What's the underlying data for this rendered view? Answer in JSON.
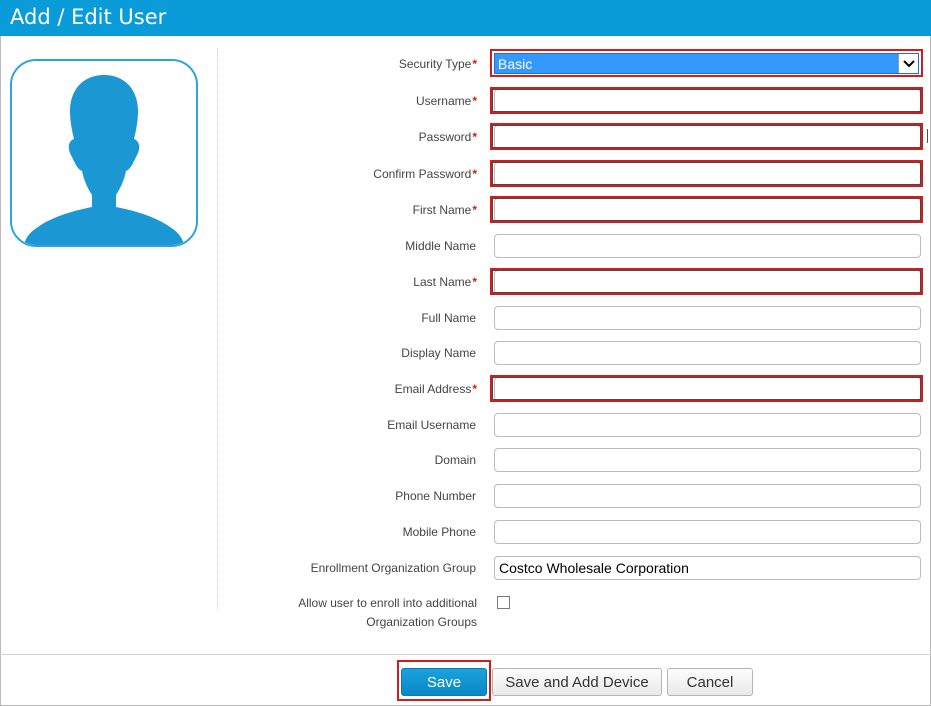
{
  "window": {
    "title": "Add / Edit User"
  },
  "form": {
    "security_type": {
      "label": "Security Type",
      "required_mark": "*",
      "value": "Basic"
    },
    "fields": [
      {
        "key": "username",
        "label": "Username",
        "required": "*",
        "value": ""
      },
      {
        "key": "password",
        "label": "Password",
        "required": "*",
        "value": ""
      },
      {
        "key": "confirm_password",
        "label": "Confirm Password",
        "required": "*",
        "value": ""
      },
      {
        "key": "first_name",
        "label": "First Name",
        "required": "*",
        "value": ""
      },
      {
        "key": "middle_name",
        "label": "Middle Name",
        "required": "",
        "value": ""
      },
      {
        "key": "last_name",
        "label": "Last Name",
        "required": "*",
        "value": ""
      },
      {
        "key": "full_name",
        "label": "Full Name",
        "required": "",
        "value": ""
      },
      {
        "key": "display_name",
        "label": "Display Name",
        "required": "",
        "value": ""
      },
      {
        "key": "email_address",
        "label": "Email Address",
        "required": "*",
        "value": ""
      },
      {
        "key": "email_username",
        "label": "Email Username",
        "required": "",
        "value": ""
      },
      {
        "key": "domain",
        "label": "Domain",
        "required": "",
        "value": ""
      },
      {
        "key": "phone_number",
        "label": "Phone Number",
        "required": "",
        "value": ""
      },
      {
        "key": "mobile_phone",
        "label": "Mobile Phone",
        "required": "",
        "value": ""
      },
      {
        "key": "enrollment_og",
        "label": "Enrollment Organization Group",
        "required": "",
        "value": "Costco Wholesale Corporation"
      }
    ],
    "allow_additional_og": {
      "label_line1": "Allow user to enroll into additional",
      "label_line2": "Organization Groups",
      "checked": false
    }
  },
  "buttons": {
    "save": "Save",
    "save_and_add_device": "Save and Add Device",
    "cancel": "Cancel"
  },
  "colors": {
    "title_bar": "#0a9cd8",
    "accent": "#2ea3dd",
    "required": "#d01d1d",
    "highlight_box": "#d01d1d",
    "select_bg": "#3399ff"
  }
}
